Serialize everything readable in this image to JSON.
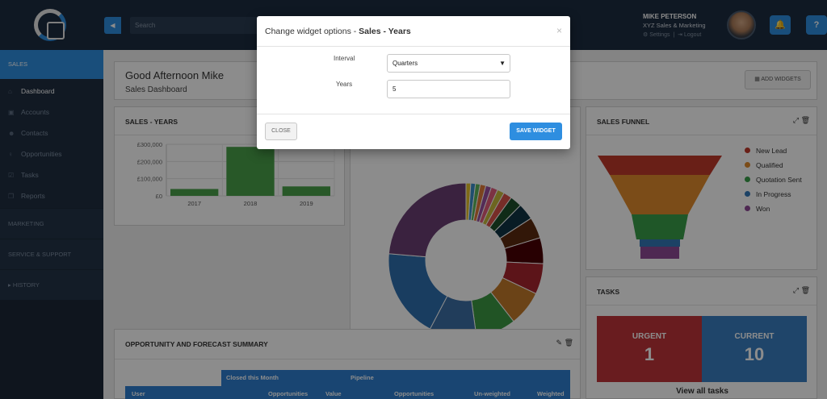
{
  "header": {
    "search_placeholder": "Search",
    "user": {
      "name": "MIKE PETERSON",
      "company": "XYZ Sales & Marketing",
      "settings_label": "Settings",
      "logout_label": "Logout"
    },
    "notifications_icon": "bell-icon",
    "help_label": "?"
  },
  "sidebar": {
    "section": "SALES",
    "items": [
      {
        "label": "Dashboard",
        "icon": "home-icon",
        "active": true
      },
      {
        "label": "Accounts",
        "icon": "briefcase-icon"
      },
      {
        "label": "Contacts",
        "icon": "users-icon"
      },
      {
        "label": "Opportunities",
        "icon": "lightbulb-icon"
      },
      {
        "label": "Tasks",
        "icon": "checkbox-icon"
      },
      {
        "label": "Reports",
        "icon": "copy-icon"
      }
    ],
    "other_sections": [
      "MARKETING",
      "SERVICE & SUPPORT",
      "HISTORY"
    ]
  },
  "dashboard": {
    "greeting": "Good Afternoon Mike",
    "subtitle": "Sales Dashboard",
    "add_widgets_label": "ADD WIDGETS"
  },
  "widgets": {
    "sales_years": {
      "title": "SALES - YEARS"
    },
    "sales_funnel": {
      "title": "SALES FUNNEL",
      "legend": [
        {
          "label": "New Lead",
          "color": "#c0392b"
        },
        {
          "label": "Qualified",
          "color": "#e08a2c"
        },
        {
          "label": "Quotation Sent",
          "color": "#3a9e49"
        },
        {
          "label": "In Progress",
          "color": "#3479b8"
        },
        {
          "label": "Won",
          "color": "#8e4a96"
        }
      ]
    },
    "tasks": {
      "title": "TASKS",
      "urgent_label": "URGENT",
      "urgent_count": "1",
      "current_label": "CURRENT",
      "current_count": "10",
      "view_all_label": "View all tasks"
    },
    "opportunity_summary": {
      "title": "OPPORTUNITY AND FORECAST SUMMARY",
      "group_headers": [
        "Closed this Month",
        "Pipeline"
      ],
      "columns": [
        "User",
        "Opportunities",
        "Value",
        "Opportunities",
        "Un-weighted",
        "Weighted"
      ]
    }
  },
  "chart_data": [
    {
      "type": "bar",
      "categories": [
        "2017",
        "2018",
        "2019"
      ],
      "values": [
        40000,
        285000,
        55000
      ],
      "ylim": [
        0,
        300000
      ],
      "yticks": [
        "£0",
        "£100,000",
        "£200,000",
        "£300,000"
      ],
      "color": "#4aa04a"
    },
    {
      "type": "pie",
      "donut": true,
      "values": [
        1,
        1,
        1,
        1.2,
        1.2,
        1.4,
        1.5,
        1.8,
        2.5,
        3.5,
        4.5,
        5.5,
        6.5,
        7.5,
        8.5,
        10,
        19,
        24
      ],
      "colors": [
        "#e6c229",
        "#3a8fc9",
        "#5bb75b",
        "#e07b39",
        "#9a4f9e",
        "#e25b7b",
        "#c7b93b",
        "#d9524a",
        "#1e4f2a",
        "#0f3444",
        "#5b2a10",
        "#4a0004",
        "#a8262e",
        "#c47a2a",
        "#3d9a44",
        "#3c6fa6",
        "#2f6fb0",
        "#6b3f73"
      ]
    }
  ],
  "modal": {
    "title_prefix": "Change widget options - ",
    "title_bold": "Sales - Years",
    "close_icon": "×",
    "interval_label": "Interval",
    "interval_value": "Quarters",
    "years_label": "Years",
    "years_value": "5",
    "close_button": "CLOSE",
    "save_button": "SAVE WIDGET"
  }
}
